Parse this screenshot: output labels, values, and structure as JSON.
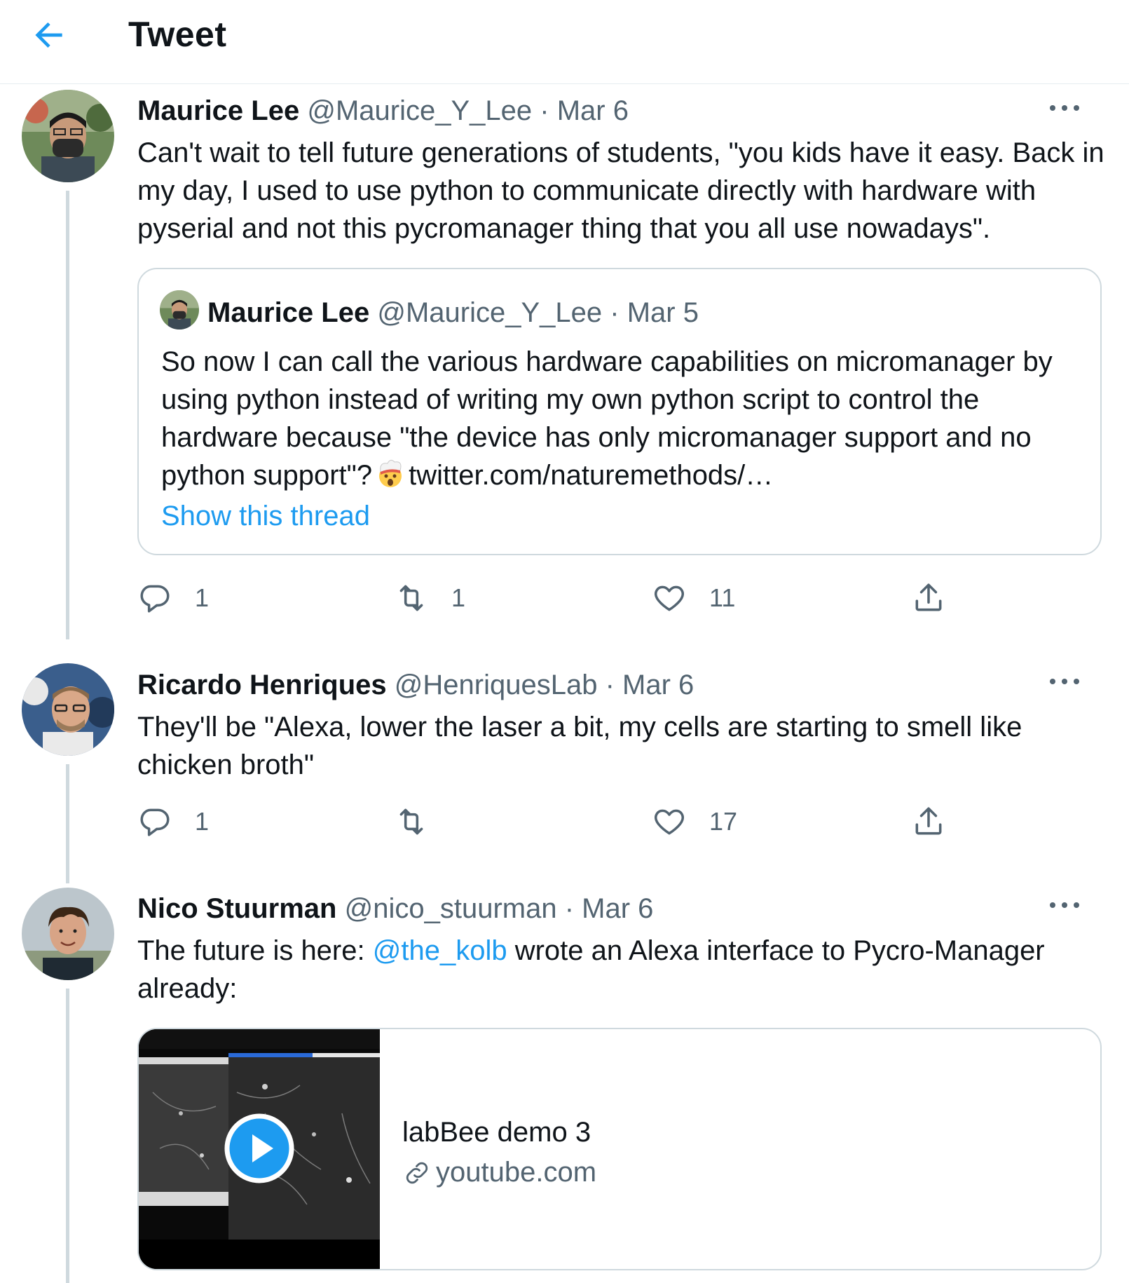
{
  "header": {
    "title": "Tweet"
  },
  "tweets": [
    {
      "name": "Maurice Lee",
      "handle": "@Maurice_Y_Lee",
      "dot": "·",
      "date": "Mar 6",
      "text": "Can't wait to tell future generations of students, \"you kids have it easy. Back in my day, I used to use python to communicate directly with hardware with pyserial and not this pycromanager thing that you all use nowadays\".",
      "quote": {
        "name": "Maurice Lee",
        "handle": "@Maurice_Y_Lee",
        "dot": "·",
        "date": "Mar 5",
        "text_before": "So now I can call the various hardware capabilities on micromanager by using python instead of writing my own python script to control the hardware because \"the device has only micromanager support and no python support\"?",
        "text_after": "twitter.com/naturemethods/…",
        "emoji": "exploding-head-emoji",
        "show_thread": "Show this thread"
      },
      "actions": {
        "replies": "1",
        "retweets": "1",
        "likes": "11"
      }
    },
    {
      "name": "Ricardo Henriques",
      "handle": "@HenriquesLab",
      "dot": "·",
      "date": "Mar 6",
      "text": "They'll be \"Alexa, lower the laser a bit, my cells are starting to smell like chicken broth\"",
      "actions": {
        "replies": "1",
        "retweets": "",
        "likes": "17"
      }
    },
    {
      "name": "Nico Stuurman",
      "handle": "@nico_stuurman",
      "dot": "·",
      "date": "Mar 6",
      "text_before": "The future is here: ",
      "mention": "@the_kolb",
      "text_after": " wrote an Alexa interface to Pycro-Manager already:",
      "card": {
        "title": "labBee demo 3",
        "domain": "youtube.com"
      }
    }
  ],
  "icons": {
    "back": "arrow-left-icon",
    "more": "more-dots-icon",
    "reply": "reply-icon",
    "retweet": "retweet-icon",
    "like": "heart-icon",
    "share": "share-icon",
    "play": "play-icon",
    "link": "link-icon"
  },
  "colors": {
    "accent": "#1d9bf0",
    "secondary_text": "#536471",
    "border": "#cfd9de"
  }
}
